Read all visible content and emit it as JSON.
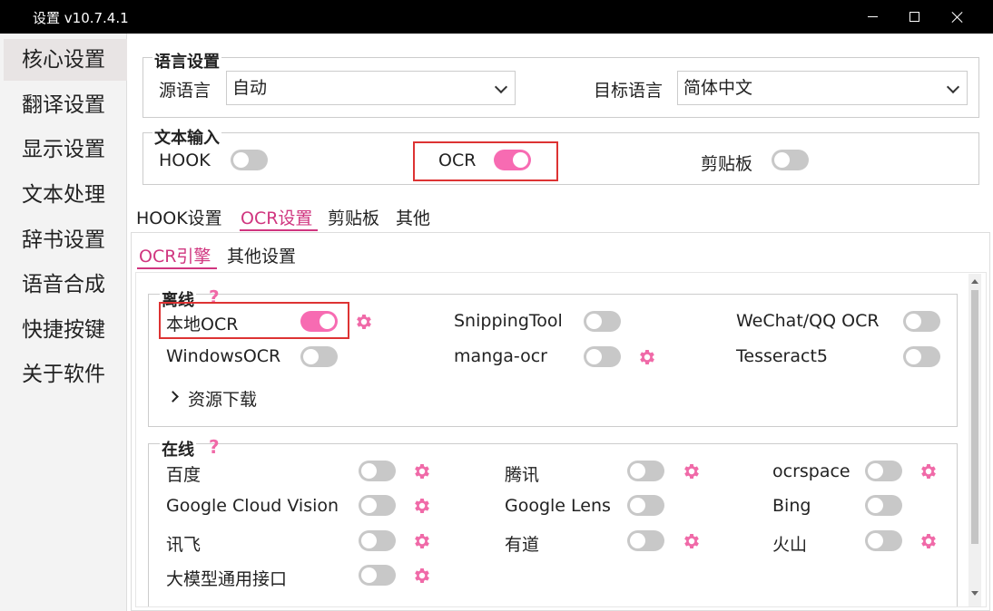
{
  "window": {
    "title": "设置 v10.7.4.1"
  },
  "sidebar": {
    "items": [
      {
        "label": "核心设置",
        "active": true
      },
      {
        "label": "翻译设置"
      },
      {
        "label": "显示设置"
      },
      {
        "label": "文本处理"
      },
      {
        "label": "辞书设置"
      },
      {
        "label": "语音合成"
      },
      {
        "label": "快捷按键"
      },
      {
        "label": "关于软件"
      }
    ]
  },
  "language": {
    "group_title": "语言设置",
    "source_label": "源语言",
    "source_value": "自动",
    "target_label": "目标语言",
    "target_value": "简体中文"
  },
  "text_input": {
    "group_title": "文本输入",
    "hook_label": "HOOK",
    "hook_on": false,
    "ocr_label": "OCR",
    "ocr_on": true,
    "clipboard_label": "剪贴板",
    "clipboard_on": false
  },
  "tabs": {
    "items": [
      "HOOK设置",
      "OCR设置",
      "剪贴板",
      "其他"
    ],
    "active": "OCR设置"
  },
  "subtabs": {
    "items": [
      "OCR引擎",
      "其他设置"
    ],
    "active": "OCR引擎"
  },
  "offline": {
    "title": "离线",
    "help": "?",
    "engines": [
      {
        "name": "本地OCR",
        "on": true
      },
      {
        "name": "SnippingTool",
        "on": false
      },
      {
        "name": "WeChat/QQ OCR",
        "on": false
      },
      {
        "name": "WindowsOCR",
        "on": false
      },
      {
        "name": "manga-ocr",
        "on": false
      },
      {
        "name": "Tesseract5",
        "on": false
      }
    ],
    "resource_download": "资源下载"
  },
  "online": {
    "title": "在线",
    "help": "?",
    "engines": [
      {
        "name": "百度",
        "on": false
      },
      {
        "name": "腾讯",
        "on": false
      },
      {
        "name": "ocrspace",
        "on": false
      },
      {
        "name": "Google Cloud Vision",
        "on": false
      },
      {
        "name": "Google Lens",
        "on": false
      },
      {
        "name": "Bing",
        "on": false
      },
      {
        "name": "讯飞",
        "on": false
      },
      {
        "name": "有道",
        "on": false
      },
      {
        "name": "火山",
        "on": false
      },
      {
        "name": "大模型通用接口",
        "on": false
      }
    ]
  },
  "colors": {
    "accent": "#f76bb2",
    "tab_active": "#d0357f",
    "highlight_box": "#dd3333"
  }
}
